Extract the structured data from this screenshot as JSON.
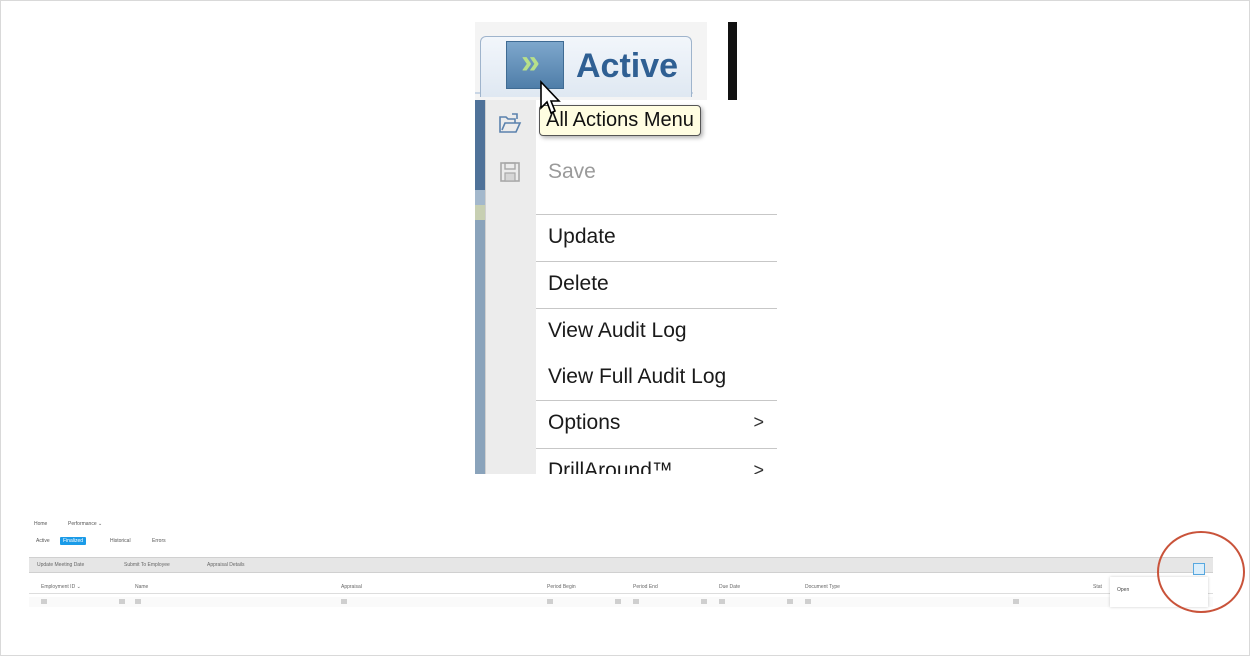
{
  "zoomed": {
    "tab_label": "Active",
    "tooltip": "All Actions Menu",
    "menu_items": [
      {
        "label": "Save",
        "icon": "save-icon",
        "disabled": true
      },
      {
        "label": "Update"
      },
      {
        "label": "Delete"
      },
      {
        "label": "View Audit Log"
      },
      {
        "label": "View Full Audit Log"
      },
      {
        "label": "Options",
        "submenu_icon": "chevron-right-icon",
        "submenu_glyph": ">"
      },
      {
        "label": "DrillAround™",
        "submenu_icon": "chevron-right-icon",
        "submenu_glyph": ">"
      }
    ],
    "top_icon": "open-folder-icon"
  },
  "app": {
    "breadcrumb": [
      "Home",
      "Performance ⌄"
    ],
    "tabs": [
      {
        "label": "Active",
        "selected": false
      },
      {
        "label": "Finalized",
        "selected": true
      },
      {
        "label": "Historical",
        "selected": false
      },
      {
        "label": "Errors",
        "selected": false
      }
    ],
    "toolbar": [
      "Update Meeting Date",
      "Submit To Employee",
      "Appraisal Details"
    ],
    "columns": [
      "Employment ID ⌄",
      "Name",
      "Appraisal",
      "Period Begin",
      "Period End",
      "Due Date",
      "Document Type",
      "Stat"
    ],
    "popup_option": "Open"
  },
  "colors": {
    "accent": "#1a9be8",
    "highlight_circle": "#c9533a",
    "tab_text": "#2f5f93"
  }
}
